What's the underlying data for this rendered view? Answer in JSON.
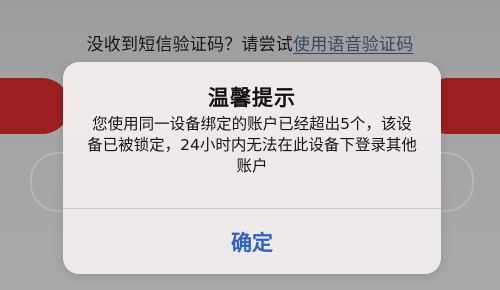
{
  "background": {
    "hint_text": "没收到短信验证码？请尝试",
    "voice_link": "使用语音验证码"
  },
  "dialog": {
    "title": "温馨提示",
    "message": "您使用同一设备绑定的账户已经超出5个，该设备已被锁定，24小时内无法在此设备下登录其他账户",
    "confirm_label": "确定"
  },
  "colors": {
    "accent_blue": "#2d63bf",
    "brand_red": "#9c1f1f"
  }
}
